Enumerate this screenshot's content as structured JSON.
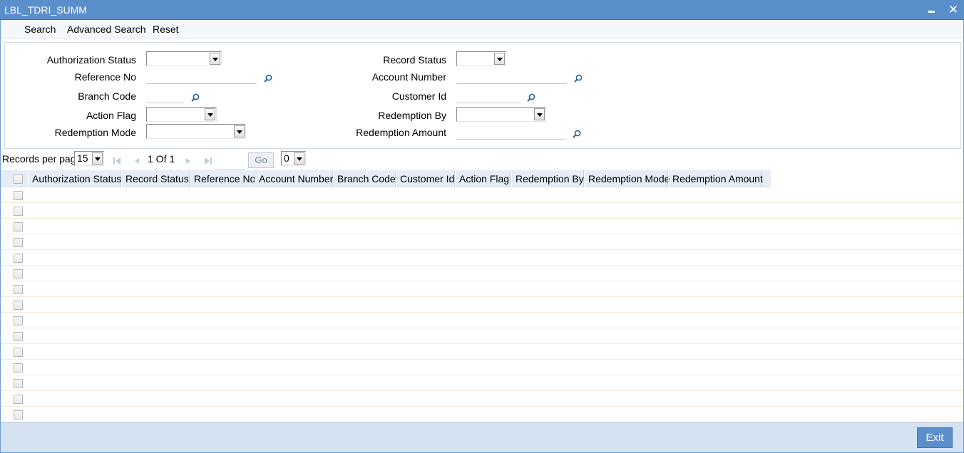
{
  "window": {
    "title": "LBL_TDRI_SUMM",
    "minimize_icon": "minimize-icon",
    "close_icon": "close-icon"
  },
  "toolbar": {
    "search": "Search",
    "advanced_search": "Advanced Search",
    "reset": "Reset"
  },
  "criteria": {
    "authorization_status": {
      "label": "Authorization Status",
      "value": ""
    },
    "record_status": {
      "label": "Record Status",
      "value": ""
    },
    "reference_no": {
      "label": "Reference No",
      "value": ""
    },
    "account_number": {
      "label": "Account Number",
      "value": ""
    },
    "branch_code": {
      "label": "Branch Code",
      "value": ""
    },
    "customer_id": {
      "label": "Customer Id",
      "value": ""
    },
    "action_flag": {
      "label": "Action Flag",
      "value": ""
    },
    "redemption_by": {
      "label": "Redemption By",
      "value": ""
    },
    "redemption_mode": {
      "label": "Redemption Mode",
      "value": ""
    },
    "redemption_amount": {
      "label": "Redemption Amount",
      "value": ""
    }
  },
  "pager": {
    "records_per_page_label": "Records per page",
    "records_per_page": "15",
    "page_info": "1 Of 1",
    "go_label": "Go",
    "page_select": "0"
  },
  "grid": {
    "columns": [
      "Authorization Status",
      "Record Status",
      "Reference No",
      "Account Number",
      "Branch Code",
      "Customer Id",
      "Action Flag",
      "Redemption By",
      "Redemption Mode",
      "Redemption Amount"
    ],
    "row_count": 15
  },
  "footer": {
    "exit_label": "Exit"
  },
  "colors": {
    "title_bar": "#5b8fcb",
    "footer": "#d5e2f1",
    "header_row": "#e6edf6"
  }
}
